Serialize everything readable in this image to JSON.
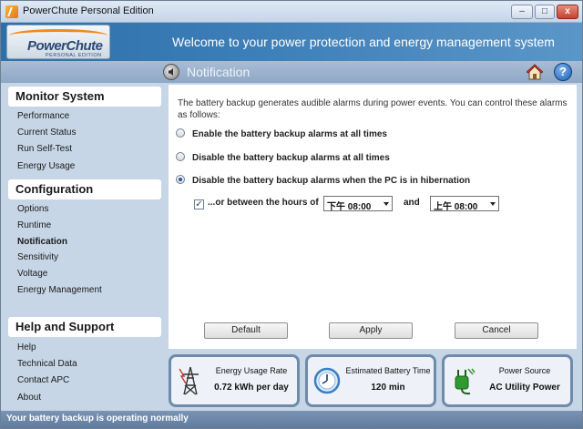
{
  "window": {
    "title": "PowerChute Personal Edition",
    "buttons": {
      "minimize": "–",
      "maximize": "□",
      "close": "x"
    }
  },
  "banner": {
    "logo_main": "PowerChute",
    "logo_sub": "PERSONAL EDITION",
    "welcome": "Welcome to your power protection and energy management system"
  },
  "section": {
    "title": "Notification",
    "icons": [
      "speaker-icon",
      "home-icon",
      "help-icon"
    ],
    "help_glyph": "?"
  },
  "sidebar": {
    "groups": [
      {
        "title": "Monitor System",
        "items": [
          "Performance",
          "Current Status",
          "Run Self-Test",
          "Energy Usage"
        ]
      },
      {
        "title": "Configuration",
        "items": [
          "Options",
          "Runtime",
          "Notification",
          "Sensitivity",
          "Voltage",
          "Energy Management"
        ]
      },
      {
        "title": "Help and Support",
        "items": [
          "Help",
          "Technical Data",
          "Contact APC",
          "About"
        ]
      }
    ],
    "active_item": "Notification"
  },
  "main": {
    "intro": "The battery backup generates audible alarms during power events. You can control these alarms as follows:",
    "options": [
      {
        "label": "Enable the battery backup alarms at all times",
        "checked": false
      },
      {
        "label": "Disable the battery backup alarms at all times",
        "checked": false
      },
      {
        "label": "Disable the battery backup alarms when the PC is in hibernation",
        "checked": true
      }
    ],
    "between": {
      "checked": true,
      "check_glyph": "✓",
      "label": "...or between the hours of",
      "from_value": "下午 08:00",
      "and_label": "and",
      "to_value": "上午 08:00"
    },
    "buttons": {
      "default": "Default",
      "apply": "Apply",
      "cancel": "Cancel"
    }
  },
  "cards": [
    {
      "title": "Energy Usage Rate",
      "value": "0.72 kWh per day",
      "icon": "power-tower-icon"
    },
    {
      "title": "Estimated Battery Time",
      "value": "120 min",
      "icon": "clock-icon"
    },
    {
      "title": "Power Source",
      "value": "AC Utility Power",
      "icon": "plug-icon"
    }
  ],
  "statusbar": {
    "text": "Your battery backup is operating normally"
  },
  "colors": {
    "banner_blue": "#3b7db7",
    "strip": "#8ea8c6",
    "window_bg": "#c7d6e6",
    "card_border": "#6f8bab",
    "statusbar": "#6a86aa"
  }
}
